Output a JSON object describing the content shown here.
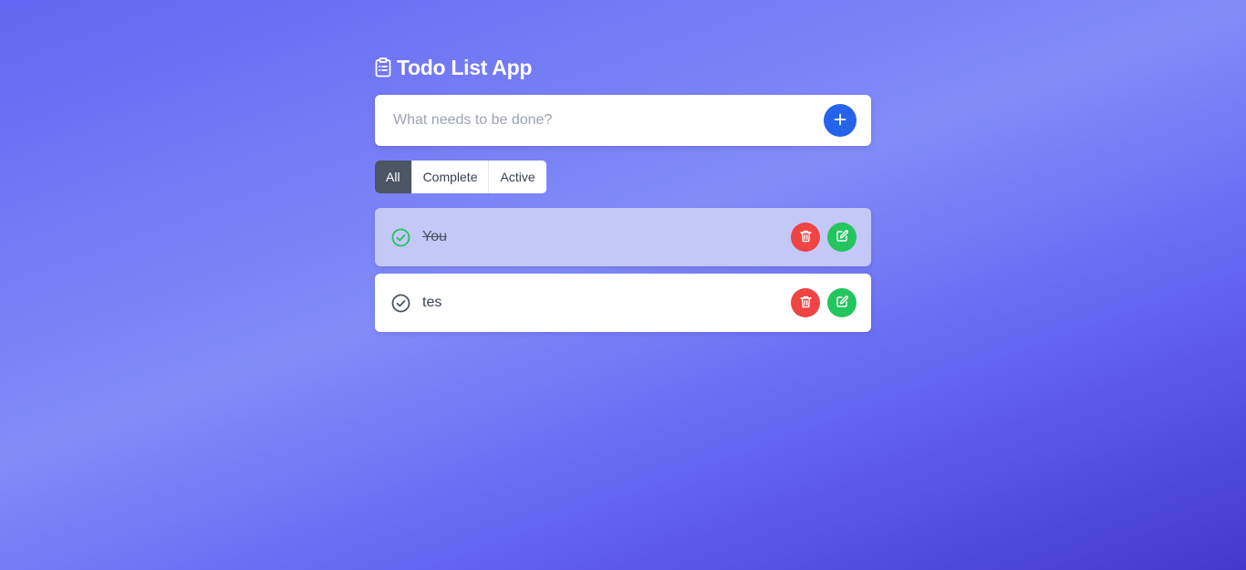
{
  "app": {
    "title": "Todo List App",
    "title_icon": "clipboard-list-icon"
  },
  "new_todo": {
    "placeholder": "What needs to be done?",
    "value": "",
    "add_icon": "plus-icon",
    "add_color": "#2563eb"
  },
  "filters": {
    "all": "All",
    "complete": "Complete",
    "active": "Active",
    "selected": "All"
  },
  "todos": [
    {
      "text": "You",
      "completed": true,
      "check_icon": "check-circle-icon",
      "check_color": "#22c55e"
    },
    {
      "text": "tes",
      "completed": false,
      "check_icon": "check-circle-icon",
      "check_color": "#4b5563"
    }
  ],
  "colors": {
    "delete": "#ef4444",
    "edit": "#22c55e",
    "active_filter": "#4b5563",
    "completed_row": "#c3c8f7"
  }
}
